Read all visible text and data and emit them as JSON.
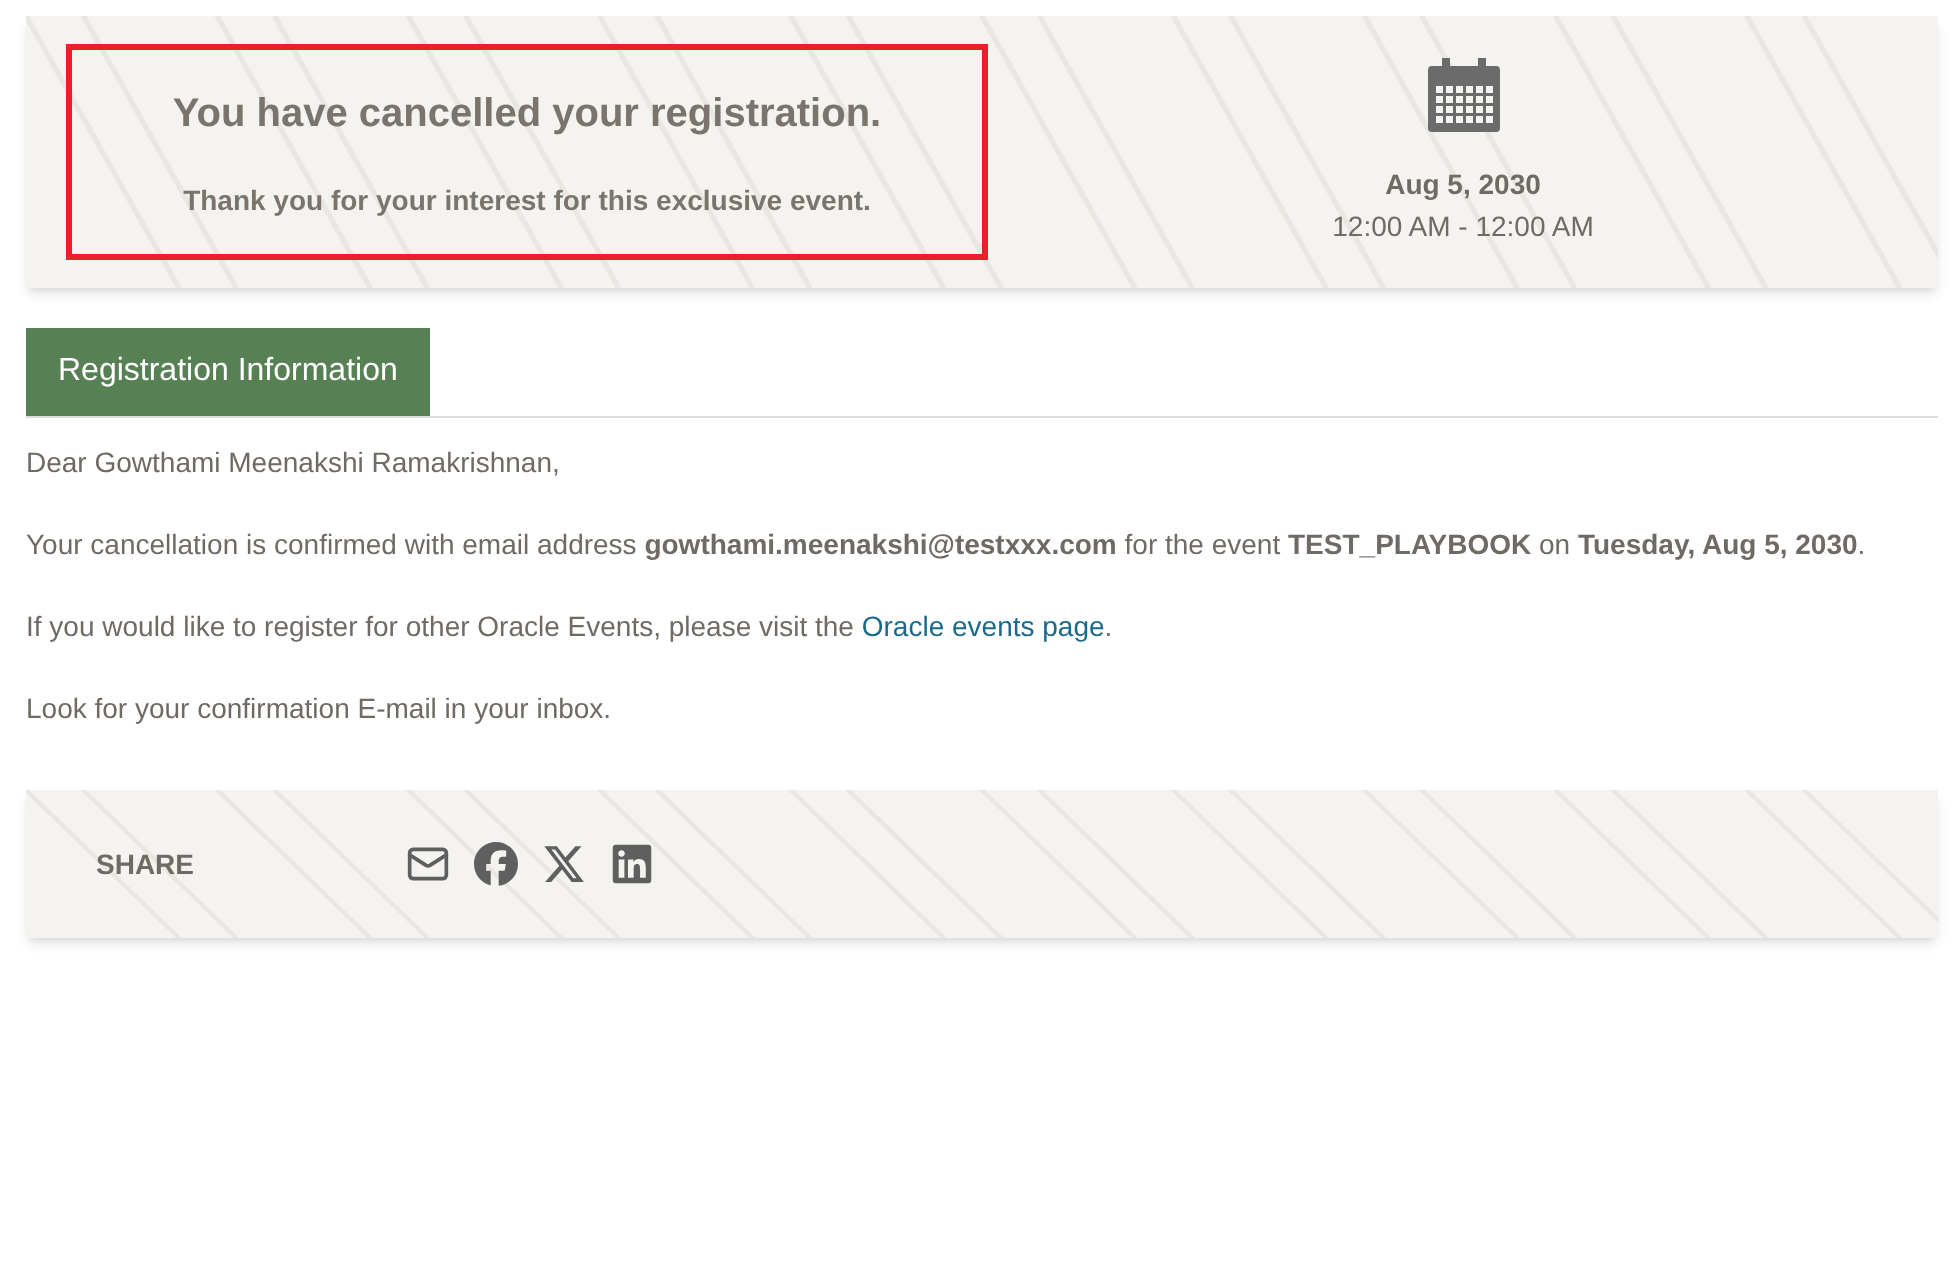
{
  "banner": {
    "title": "You have cancelled your registration.",
    "subtitle": "Thank you for your interest for this exclusive event.",
    "date": "Aug 5, 2030",
    "time": "12:00 AM - 12:00 AM"
  },
  "tabs": [
    {
      "label": "Registration Information",
      "selected": true
    }
  ],
  "body": {
    "greeting": "Dear Gowthami Meenakshi Ramakrishnan,",
    "confirmation": "Your cancellation is confirmed with email address **gowthami.meenakshi@testxxx.com** for the event **TEST_PLAYBOOK** on **Tuesday, Aug 5, 2030**.",
    "visit": {
      "before": "If you would like to register for other Oracle Events, please visit the ",
      "link": "Oracle events page",
      "after": "."
    },
    "reminder": "Look for your confirmation E-mail in your inbox."
  },
  "share": {
    "label": "SHARE"
  }
}
